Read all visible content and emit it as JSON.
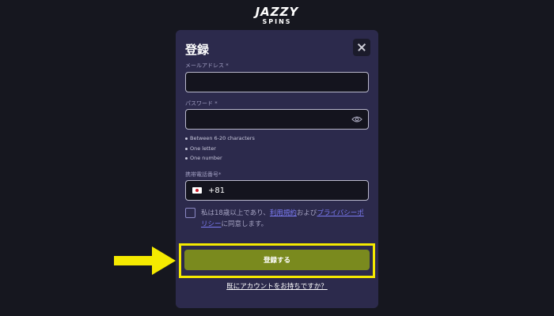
{
  "brand": {
    "line1": "JAZZY",
    "line2": "SPINS"
  },
  "modal": {
    "title": "登録",
    "email_label": "メールアドレス *",
    "email_value": "",
    "password_label": "パスワード *",
    "password_value": "",
    "password_rules": [
      "Between 6-20 characters",
      "One letter",
      "One number"
    ],
    "phone_label": "携帯電話番号*",
    "phone_country_code": "+81",
    "consent": {
      "pre": "私は18歳以上であり、",
      "terms_link": "利用規約",
      "mid": "および",
      "privacy_link": "プライバシーポリシー",
      "post": "に同意します。"
    },
    "submit_label": "登録する",
    "login_link": "既にアカウントをお持ちですか？"
  },
  "icons": {
    "close": "close-icon",
    "eye": "eye-icon",
    "flag": "japan-flag-icon",
    "arrow": "arrow-right-icon"
  },
  "colors": {
    "background": "#16171f",
    "modal": "#2c2a4c",
    "submit": "#7a8a1e",
    "highlight": "#f5ea00",
    "link": "#7b7bf3"
  }
}
